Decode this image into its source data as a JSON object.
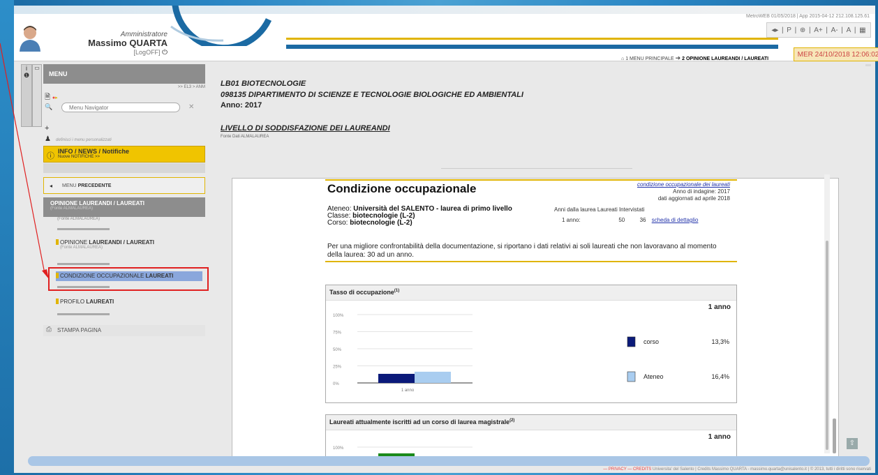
{
  "header": {
    "system_info": "MetroWEB 01/05/2018 | App 2015-04-12 212.108.125.61",
    "role": "Amministratore",
    "user_name": "Massimo QUARTA",
    "logoff": "[LogOFF]",
    "tools": [
      "◂▸",
      "|",
      "P",
      "|",
      "⊕",
      "|",
      "A+",
      "|",
      "A-",
      "|",
      "A",
      "|",
      "▦"
    ],
    "breadcrumb": {
      "item1": "1 MENU PRINCIPALE",
      "item2": "2 OPINIONE LAUREANDI / LAUREATI"
    },
    "datetime": "MER 24/10/2018 12:06:02"
  },
  "sidebar": {
    "menu_label": "MENU",
    "path": ">> EL3 > ANM",
    "search_placeholder": "Menu Navigator",
    "user_defined": "definisci i menu personalizzati",
    "info": {
      "title": "INFO / NEWS / Notifiche",
      "sub": "Nuove NOTIFICHE >>"
    },
    "prev_menu": {
      "normal": "MENU ",
      "bold": "PRECEDENTE"
    },
    "selected_head": {
      "title": "OPINIONE LAUREANDI / LAUREATI",
      "sub": "(Fonte ALMALAUREA)"
    },
    "selected_source": "(Fonte ALMALAUREA)",
    "items": [
      {
        "label_a": "OPINIONE ",
        "label_b": "LAUREANDI / LAUREATI",
        "source": "(Fonte ALMALAUREA)"
      },
      {
        "label_a": "CONDIZIONE OCCUPAZIONALE ",
        "label_b": "LAUREATI"
      },
      {
        "label_a": "PROFILO ",
        "label_b": "LAUREATI"
      }
    ],
    "print_label": "STAMPA PAGINA"
  },
  "content": {
    "course_code": "LB01 BIOTECNOLOGIE",
    "department": "098135 DIPARTIMENTO DI SCIENZE E TECNOLOGIE BIOLOGICHE ED AMBIENTALI",
    "year": "Anno: 2017",
    "section_title": "LIVELLO DI SODDISFAZIONE DEI LAUREANDI",
    "source": "Fonte Dati ALMALAUREA"
  },
  "report": {
    "heading": "Condizione occupazionale",
    "link": "condizione occupazionale dei laureati",
    "survey_year": "Anno di indagine: 2017",
    "updated": "dati aggiornati ad aprile 2018",
    "ateneo_label": "Ateneo: ",
    "ateneo_value": "Università del SALENTO - laurea di primo livello",
    "classe_label": "Classe: ",
    "classe_value": "biotecnologie (L-2)",
    "corso_label": "Corso: ",
    "corso_value": "biotecnologie (L-2)",
    "stats_header": "Anni dalla laurea  Laureati  Intervistati",
    "stats_year": "1 anno:",
    "stats_laureati": "50",
    "stats_intervistati": "36",
    "detail_link": "scheda di dettaglio",
    "note": "Per una migliore confrontabilità della documentazione, si riportano i dati relativi ai soli laureati che non lavoravano al momento della laurea: 30 ad un anno."
  },
  "panels": [
    {
      "title": "Tasso di occupazione",
      "sup": "(1)",
      "year_label": "1 anno"
    },
    {
      "title": "Laureati attualmente iscritti ad un corso di laurea magistrale",
      "sup": "(2)",
      "year_label": "1 anno"
    }
  ],
  "chart_data": [
    {
      "type": "bar",
      "title": "Tasso di occupazione",
      "categories": [
        "1 anno"
      ],
      "y_ticks": [
        "100%",
        "75%",
        "50%",
        "25%",
        "0%"
      ],
      "ylim": [
        0,
        100
      ],
      "series": [
        {
          "name": "corso",
          "values": [
            13.3
          ],
          "label": "13,3%",
          "color": "#0b1a7a"
        },
        {
          "name": "Ateneo",
          "values": [
            16.4
          ],
          "label": "16,4%",
          "color": "#a9cdf0"
        }
      ]
    },
    {
      "type": "bar",
      "title": "Laureati attualmente iscritti ad un corso di laurea magistrale",
      "y_ticks": [
        "100%"
      ],
      "ylim": [
        0,
        100
      ],
      "series": [
        {
          "name": "",
          "color": "#1a8a1a"
        }
      ]
    }
  ],
  "footer": {
    "left": "— PRIVACY — CREDITS",
    "right": "Universita' del Salento | Credits Massimo QUARTA - massimo.quarta@unisalento.it | © 2013, tutti i diritti sono riservati"
  }
}
